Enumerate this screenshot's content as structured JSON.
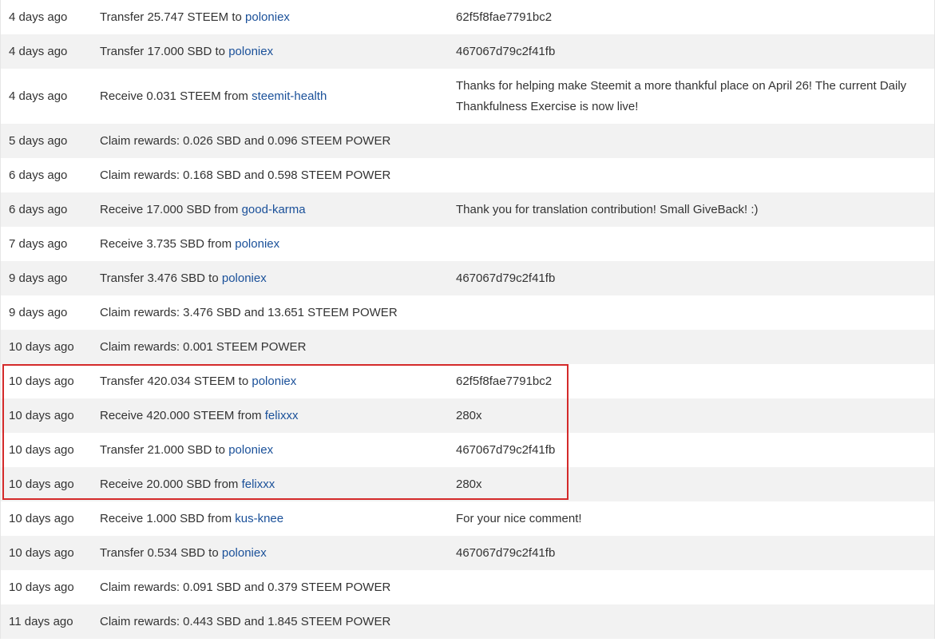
{
  "rows": [
    {
      "when": "4 days ago",
      "action": "Transfer 25.747 STEEM to",
      "user": "poloniex",
      "memo": "62f5f8fae7791bc2"
    },
    {
      "when": "4 days ago",
      "action": "Transfer 17.000 SBD to",
      "user": "poloniex",
      "memo": "467067d79c2f41fb"
    },
    {
      "when": "4 days ago",
      "action": "Receive 0.031 STEEM from",
      "user": "steemit-health",
      "memo": "Thanks for helping make Steemit a more thankful place on April 26! The current Daily Thankfulness Exercise is now live!"
    },
    {
      "when": "5 days ago",
      "action": "Claim rewards: 0.026 SBD and 0.096 STEEM POWER",
      "user": "",
      "memo": ""
    },
    {
      "when": "6 days ago",
      "action": "Claim rewards: 0.168 SBD and 0.598 STEEM POWER",
      "user": "",
      "memo": ""
    },
    {
      "when": "6 days ago",
      "action": "Receive 17.000 SBD from",
      "user": "good-karma",
      "memo": "Thank you for translation contribution! Small GiveBack! :)"
    },
    {
      "when": "7 days ago",
      "action": "Receive 3.735 SBD from",
      "user": "poloniex",
      "memo": ""
    },
    {
      "when": "9 days ago",
      "action": "Transfer 3.476 SBD to",
      "user": "poloniex",
      "memo": "467067d79c2f41fb"
    },
    {
      "when": "9 days ago",
      "action": "Claim rewards: 3.476 SBD and 13.651 STEEM POWER",
      "user": "",
      "memo": ""
    },
    {
      "when": "10 days ago",
      "action": "Claim rewards: 0.001 STEEM POWER",
      "user": "",
      "memo": ""
    },
    {
      "when": "10 days ago",
      "action": "Transfer 420.034 STEEM to",
      "user": "poloniex",
      "memo": "62f5f8fae7791bc2"
    },
    {
      "when": "10 days ago",
      "action": "Receive 420.000 STEEM from",
      "user": "felixxx",
      "memo": "280x"
    },
    {
      "when": "10 days ago",
      "action": "Transfer 21.000 SBD to",
      "user": "poloniex",
      "memo": "467067d79c2f41fb"
    },
    {
      "when": "10 days ago",
      "action": "Receive 20.000 SBD from",
      "user": "felixxx",
      "memo": "280x"
    },
    {
      "when": "10 days ago",
      "action": "Receive 1.000 SBD from",
      "user": "kus-knee",
      "memo": "For your nice comment!"
    },
    {
      "when": "10 days ago",
      "action": "Transfer 0.534 SBD to",
      "user": "poloniex",
      "memo": "467067d79c2f41fb"
    },
    {
      "when": "10 days ago",
      "action": "Claim rewards: 0.091 SBD and 0.379 STEEM POWER",
      "user": "",
      "memo": ""
    },
    {
      "when": "11 days ago",
      "action": "Claim rewards: 0.443 SBD and 1.845 STEEM POWER",
      "user": "",
      "memo": ""
    }
  ],
  "colors": {
    "link": "#1a5099",
    "text": "#333333",
    "row_alt": "#f2f2f2",
    "highlight": "#d42a2a"
  }
}
